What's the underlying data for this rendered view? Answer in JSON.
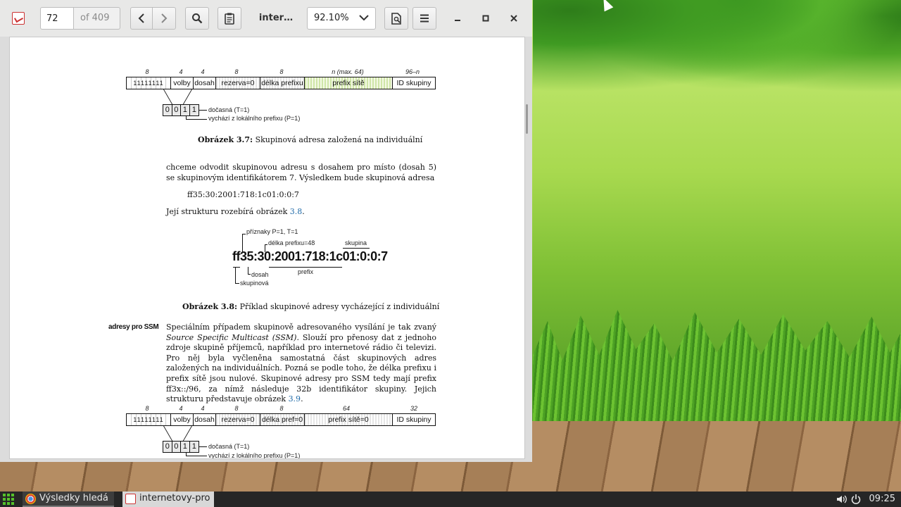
{
  "toolbar": {
    "page_number": "72",
    "page_total": "of 409",
    "document_title": "inter…",
    "zoom": "92.10%"
  },
  "document": {
    "fig37": {
      "widths": [
        "8",
        "4",
        "4",
        "8",
        "8",
        "n (max. 64)",
        "96–n"
      ],
      "ones": "11111111",
      "fields": [
        "volby",
        "dosah",
        "rezerva=0",
        "délka prefixu",
        "prefix sítě",
        "ID skupiny"
      ],
      "bits": [
        "0",
        "0",
        "1",
        "1"
      ],
      "note_t": "dočasná (T=1)",
      "note_p": "vychází z lokálního prefixu (P=1)",
      "caption_label": "Obrázek 3.7:",
      "caption_text": " Skupinová adresa založená na individuální"
    },
    "para1": "chceme odvodit skupinovou adresu s dosahem pro místo (dosah 5) se skupinovým identifikátorem 7. Výsledkem bude skupinová adresa",
    "address_line": "ff35:30:2001:718:1c01:0:0:7",
    "para2_text": "Její strukturu rozebírá obrázek ",
    "para2_link": "3.8",
    "para2_end": ".",
    "fig38": {
      "address": "ff35:30:2001:718:1c01:0:0:7",
      "flags": "příznaky P=1, T=1",
      "prefix_len": "délka prefixu=48",
      "group": "skupina",
      "prefix": "prefix",
      "scope": "dosah",
      "multicast": "skupinová",
      "caption_label": "Obrázek 3.8:",
      "caption_text": " Příklad skupinové adresy vycházející z individuální"
    },
    "margin_note": "adresy pro SSM",
    "para3_a": "Speciálním případem skupinově adresovaného vysílání je tak zvaný ",
    "para3_italic": "Source Specific Multicast (SSM)",
    "para3_b": ". Slouží pro přenosy dat z jednoho zdroje skupině příjemců, například pro internetové rádio či televizi. Pro něj byla vyčleněna samostatná část skupinových adres založených na individuálních. Pozná se podle toho, že délka prefixu i prefix sítě jsou nulové. Skupinové adresy pro SSM tedy mají prefix ff3x::/96, za nímž následuje 32b identifikátor skupiny. Jejich strukturu představuje obrázek ",
    "para3_link": "3.9",
    "para3_end": ".",
    "fig39": {
      "widths": [
        "8",
        "4",
        "4",
        "8",
        "8",
        "64",
        "32"
      ],
      "ones": "11111111",
      "fields": [
        "volby",
        "dosah",
        "rezerva=0",
        "délka pref=0",
        "prefix sítě=0",
        "ID skupiny"
      ],
      "bits": [
        "0",
        "0",
        "1",
        "1"
      ],
      "note_t": "dočasná (T=1)",
      "note_p": "vychází z lokálního prefixu (P=1)"
    }
  },
  "taskbar": {
    "tasks": [
      "Výsledky hledá",
      "internetovy-pro"
    ],
    "clock": "09:25"
  },
  "colors": {
    "accent_green": "#55c12a",
    "link_blue": "#1f6aa8",
    "taskbar_bg": "#262626"
  }
}
